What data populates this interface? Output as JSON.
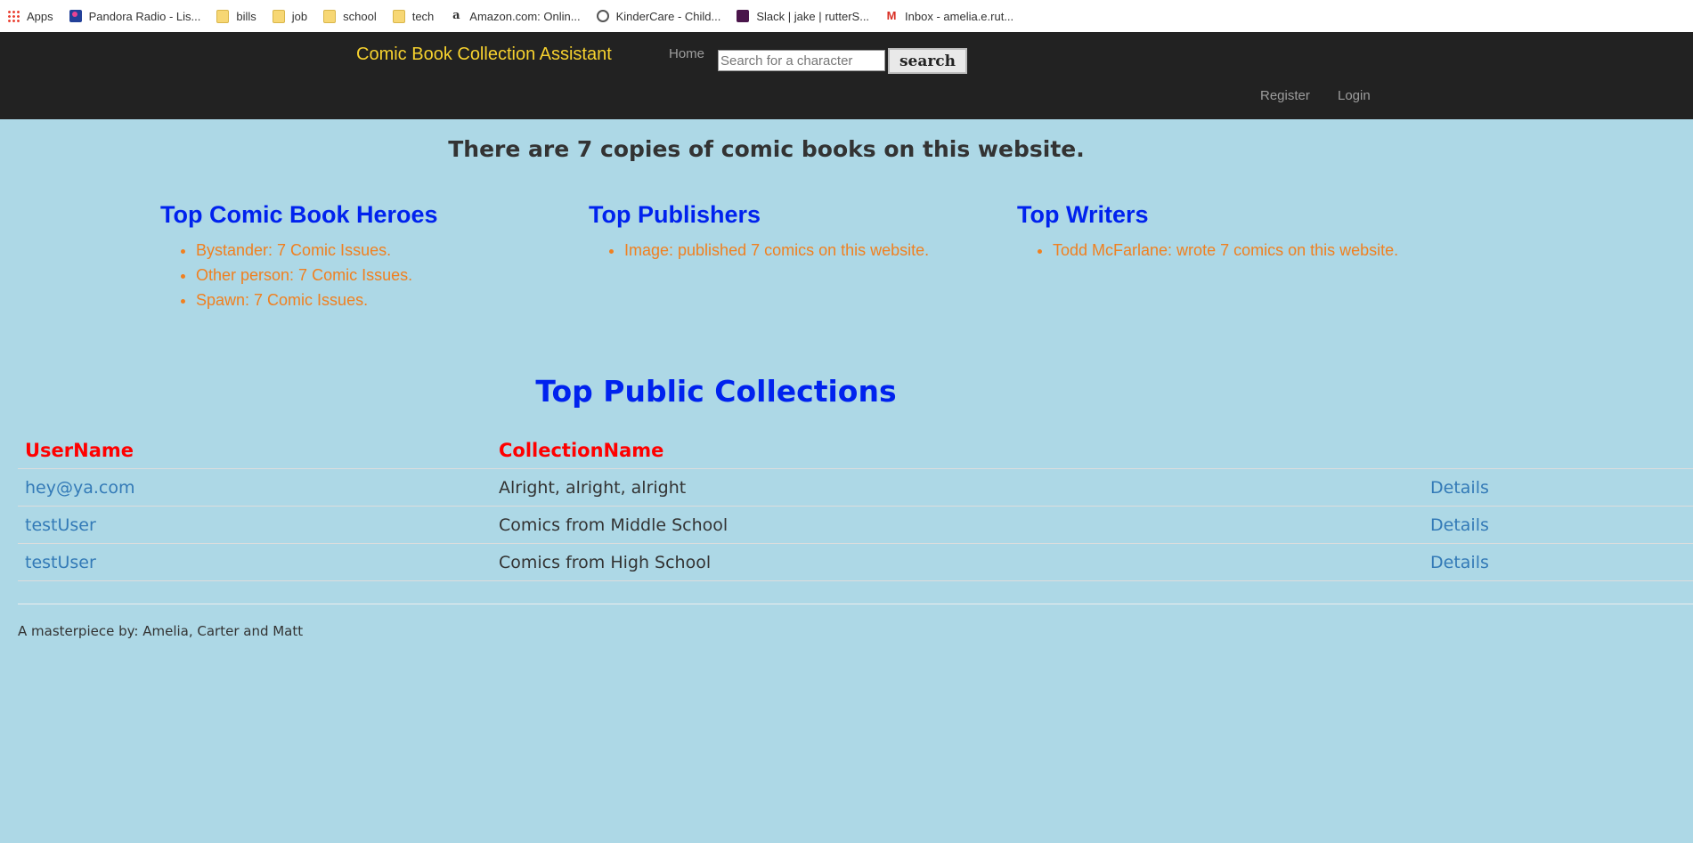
{
  "bookmarks": [
    {
      "label": "Apps",
      "icon": "apps-icon"
    },
    {
      "label": "Pandora Radio - Lis...",
      "icon": "pandora-icon"
    },
    {
      "label": "bills",
      "icon": "folder-icon"
    },
    {
      "label": "job",
      "icon": "folder-icon"
    },
    {
      "label": "school",
      "icon": "folder-icon"
    },
    {
      "label": "tech",
      "icon": "folder-icon"
    },
    {
      "label": "Amazon.com: Onlin...",
      "icon": "amazon-icon"
    },
    {
      "label": "KinderCare - Child...",
      "icon": "globe-icon"
    },
    {
      "label": "Slack | jake | rutterS...",
      "icon": "slack-icon"
    },
    {
      "label": "Inbox - amelia.e.rut...",
      "icon": "gmail-icon"
    }
  ],
  "navbar": {
    "brand": "Comic Book Collection Assistant",
    "home": "Home",
    "search_placeholder": "Search for a character",
    "search_button": "search",
    "register": "Register",
    "login": "Login"
  },
  "headline": "There are 7 copies of comic books on this website.",
  "top_heroes": {
    "title": "Top Comic Book Heroes",
    "items": [
      "Bystander: 7 Comic Issues.",
      "Other person: 7 Comic Issues.",
      "Spawn: 7 Comic Issues."
    ]
  },
  "top_publishers": {
    "title": "Top Publishers",
    "items": [
      "Image: published 7 comics on this website."
    ]
  },
  "top_writers": {
    "title": "Top Writers",
    "items": [
      "Todd McFarlane: wrote 7 comics on this website."
    ]
  },
  "collections": {
    "title": "Top Public Collections",
    "headers": [
      "UserName",
      "CollectionName"
    ],
    "rows": [
      {
        "user": "hey@ya.com",
        "name": "Alright, alright, alright",
        "action": "Details"
      },
      {
        "user": "testUser",
        "name": "Comics from Middle School",
        "action": "Details"
      },
      {
        "user": "testUser",
        "name": "Comics from High School",
        "action": "Details"
      }
    ]
  },
  "footer": "A masterpiece by: Amelia, Carter and Matt",
  "colors": {
    "background": "#add8e6",
    "navbar": "#222222",
    "brand": "#f7d22e",
    "heading_blue": "#0022ee",
    "list_orange": "#f08020",
    "table_header_red": "#ff0000",
    "link": "#337ab7"
  }
}
